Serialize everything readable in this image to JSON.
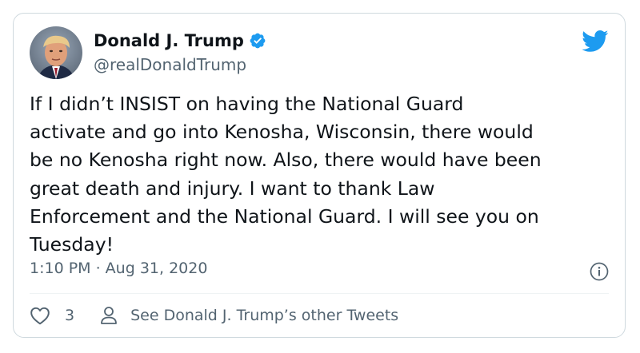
{
  "tweet": {
    "display_name": "Donald J. Trump",
    "handle": "@realDonaldTrump",
    "verified": true,
    "text": "If I didn’t INSIST on having the National Guard\nactivate and go into Kenosha, Wisconsin, there would\nbe no Kenosha right now. Also, there would have been\ngreat death and injury. I want to thank Law\nEnforcement and the National Guard. I will see you on\nTuesday!",
    "timestamp": "1:10 PM · Aug 31, 2020",
    "like_count": "3",
    "see_other_label": "See Donald J. Trump’s other Tweets"
  },
  "icons": {
    "brand": "twitter-bird-icon",
    "verified": "verified-badge-icon",
    "info": "info-icon",
    "like": "heart-icon",
    "profile": "person-icon"
  },
  "colors": {
    "brand_blue": "#1d9bf0",
    "text": "#0f1419",
    "secondary": "#536471",
    "border": "#cfd9de"
  }
}
